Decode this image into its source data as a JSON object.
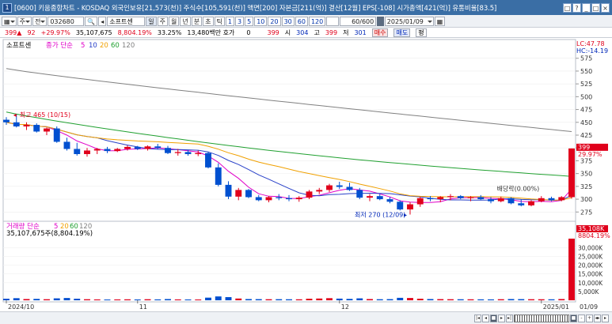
{
  "window": {
    "icon_glyph": "1",
    "title": "[0600] 키움종합차트 - KOSDAQ 외국인보유[21,573(천)] 주식수[105,591(천)] 액면[200] 자본금[211(억)] 결산[12월] EPS[-108] 시가총액[421(억)] 유통비율[83.5]",
    "buttons": [
      "□",
      "?",
      "_",
      "□",
      "×"
    ]
  },
  "toolbar": {
    "combo1": "▦",
    "combo2": "주",
    "combo3": "전",
    "code": "032680",
    "search_glyph": "🔍",
    "prev_glyph": "◂",
    "name": "소프트센",
    "periods": [
      "일",
      "주",
      "월",
      "년",
      "분",
      "초",
      "틱"
    ],
    "minutes": [
      "1",
      "3",
      "5",
      "10",
      "20",
      "30",
      "60",
      "120"
    ],
    "count": "60/600",
    "date": "2025/01/09",
    "grid_glyph": "▦"
  },
  "quote": {
    "price": "399",
    "arrow": "▲",
    "change": "92",
    "change_pct": "+29.97%",
    "volume": "35,107,675",
    "vol_ratio": "8,804.19%",
    "turnover": "33.25%",
    "amount": "13,480백만",
    "hoga_label": "호가",
    "hoga_val": "0",
    "cur": "399",
    "open_label": "시",
    "open": "304",
    "high_label": "고",
    "high": "399",
    "low_label": "저",
    "low": "301",
    "buy_label": "매수",
    "sell_label": "매도",
    "avg_label": "평"
  },
  "price_panel": {
    "series_label": "소프트센",
    "ma_label": "종가 단순",
    "ma_periods": [
      "5",
      "10",
      "20",
      "60",
      "120"
    ],
    "ma_colors": [
      "#e000c8",
      "#2840c8",
      "#f0a000",
      "#20a030",
      "#808080"
    ],
    "lc_label": "LC:47.78",
    "hc_label": "HC:-14.19",
    "y_ticks": [
      "575",
      "550",
      "525",
      "500",
      "475",
      "450",
      "425",
      "400",
      "375",
      "350",
      "325",
      "300",
      "275"
    ],
    "current_tag": "399",
    "current_pct": "29.97%",
    "annotations": {
      "high": "최고 465 (10/15)",
      "low": "최저 270 (12/09)",
      "dividend": "배당락(0.00%)"
    }
  },
  "volume_panel": {
    "label": "거래량 단순",
    "ma_periods": [
      "5",
      "20",
      "60",
      "120"
    ],
    "current_text": "35,107,675주(8,804.19%)",
    "y_ticks": [
      "30,000K",
      "25,000K",
      "20,000K",
      "15,000K",
      "10,000K",
      "5,000K"
    ],
    "current_tag": "35,108K",
    "current_pct": "8804.19%"
  },
  "x_axis": {
    "labels": [
      {
        "text": "2024/10",
        "index": 0
      },
      {
        "text": "11",
        "index": 13
      },
      {
        "text": "12",
        "index": 33
      },
      {
        "text": "2025/01",
        "index": 53
      }
    ],
    "right_label": "01/09"
  },
  "chart_data": {
    "type": "candlestick",
    "dates_note": "daily, 2024/10 ~ 2025/01/09",
    "ylim": [
      260,
      590
    ],
    "colors": {
      "up": "#e0001b",
      "down": "#0050d0"
    },
    "ohlc": [
      [
        455,
        460,
        445,
        450
      ],
      [
        450,
        465,
        440,
        442
      ],
      [
        442,
        450,
        435,
        445
      ],
      [
        445,
        448,
        430,
        432
      ],
      [
        432,
        440,
        425,
        438
      ],
      [
        438,
        442,
        410,
        412
      ],
      [
        412,
        420,
        395,
        398
      ],
      [
        398,
        410,
        385,
        388
      ],
      [
        388,
        400,
        383,
        395
      ],
      [
        395,
        400,
        388,
        398
      ],
      [
        398,
        402,
        390,
        394
      ],
      [
        394,
        400,
        392,
        398
      ],
      [
        398,
        405,
        395,
        402
      ],
      [
        402,
        404,
        396,
        398
      ],
      [
        398,
        405,
        395,
        403
      ],
      [
        403,
        408,
        398,
        400
      ],
      [
        400,
        404,
        388,
        390
      ],
      [
        390,
        398,
        385,
        392
      ],
      [
        392,
        396,
        385,
        388
      ],
      [
        388,
        395,
        384,
        390
      ],
      [
        390,
        392,
        360,
        362
      ],
      [
        362,
        370,
        325,
        328
      ],
      [
        328,
        335,
        300,
        305
      ],
      [
        305,
        322,
        298,
        318
      ],
      [
        318,
        320,
        302,
        304
      ],
      [
        304,
        308,
        296,
        298
      ],
      [
        298,
        306,
        294,
        304
      ],
      [
        304,
        310,
        298,
        302
      ],
      [
        302,
        308,
        296,
        300
      ],
      [
        300,
        306,
        295,
        303
      ],
      [
        303,
        318,
        300,
        315
      ],
      [
        315,
        322,
        310,
        318
      ],
      [
        318,
        330,
        314,
        327
      ],
      [
        327,
        334,
        320,
        324
      ],
      [
        324,
        332,
        316,
        318
      ],
      [
        318,
        322,
        300,
        303
      ],
      [
        303,
        310,
        296,
        306
      ],
      [
        306,
        310,
        298,
        300
      ],
      [
        300,
        304,
        292,
        295
      ],
      [
        295,
        298,
        278,
        280
      ],
      [
        280,
        294,
        270,
        290
      ],
      [
        290,
        305,
        285,
        302
      ],
      [
        302,
        306,
        296,
        300
      ],
      [
        300,
        306,
        294,
        304
      ],
      [
        304,
        310,
        298,
        306
      ],
      [
        306,
        308,
        300,
        302
      ],
      [
        302,
        306,
        296,
        304
      ],
      [
        304,
        308,
        298,
        300
      ],
      [
        300,
        304,
        292,
        296
      ],
      [
        296,
        305,
        294,
        302
      ],
      [
        302,
        304,
        290,
        292
      ],
      [
        292,
        300,
        286,
        288
      ],
      [
        288,
        298,
        286,
        296
      ],
      [
        296,
        306,
        294,
        302
      ],
      [
        302,
        305,
        296,
        298
      ],
      [
        298,
        306,
        296,
        304
      ],
      [
        304,
        399,
        301,
        399
      ]
    ],
    "volume_k": [
      900,
      1200,
      700,
      800,
      600,
      1100,
      1300,
      900,
      600,
      500,
      450,
      500,
      550,
      480,
      600,
      520,
      700,
      500,
      480,
      460,
      1500,
      2200,
      1800,
      1000,
      700,
      650,
      600,
      620,
      580,
      560,
      900,
      1000,
      1200,
      950,
      800,
      1100,
      700,
      600,
      650,
      1400,
      1300,
      900,
      700,
      650,
      600,
      580,
      560,
      540,
      520,
      600,
      700,
      650,
      600,
      580,
      560,
      700,
      35108
    ],
    "ma5": null,
    "price_unit": "KRW",
    "volume_unit": "K shares"
  }
}
